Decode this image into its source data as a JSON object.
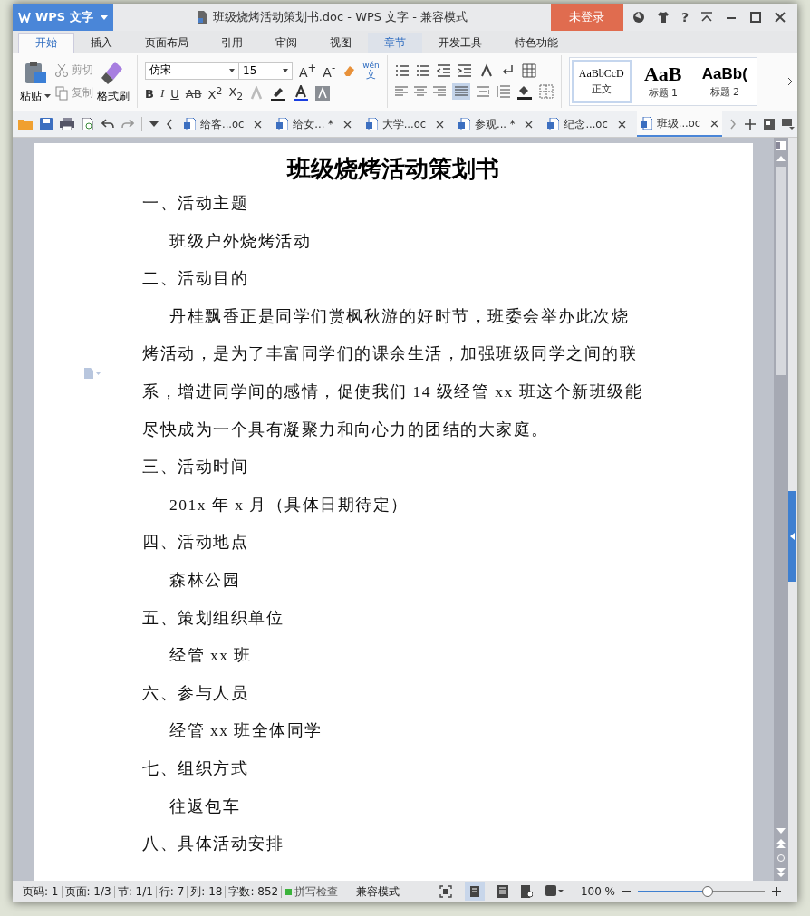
{
  "app_button": {
    "label": "WPS 文字"
  },
  "window": {
    "title": "班级烧烤活动策划书.doc - WPS 文字 - 兼容模式",
    "login": "未登录",
    "help": "?"
  },
  "menu_tabs": [
    {
      "label": "开始",
      "selected": true,
      "hovered": false
    },
    {
      "label": "插入",
      "selected": false,
      "hovered": false
    },
    {
      "label": "页面布局",
      "selected": false,
      "hovered": false
    },
    {
      "label": "引用",
      "selected": false,
      "hovered": false
    },
    {
      "label": "审阅",
      "selected": false,
      "hovered": false
    },
    {
      "label": "视图",
      "selected": false,
      "hovered": false
    },
    {
      "label": "章节",
      "selected": false,
      "hovered": true
    },
    {
      "label": "开发工具",
      "selected": false,
      "hovered": false
    },
    {
      "label": "特色功能",
      "selected": false,
      "hovered": false
    }
  ],
  "ribbon": {
    "paste": "粘贴",
    "cut": {
      "label": "剪切",
      "disabled": true
    },
    "copy": {
      "label": "复制",
      "disabled": true
    },
    "format_painter": "格式刷",
    "font": "仿宋",
    "size": "15",
    "grow": "A$^{+}$",
    "shrink": "A$^{-}$",
    "phonetic_top": "wén",
    "phonetic_bottom": "文",
    "format_buttons": [
      "B",
      "I",
      "U",
      "AB",
      "X$^{2}$",
      "X$_{2}$"
    ],
    "styles": [
      {
        "preview": "AaBbCcD",
        "name": "正文",
        "kind": "normal",
        "selected": true
      },
      {
        "preview": "AaB",
        "name": "标题 1",
        "kind": "h1",
        "selected": false
      },
      {
        "preview": "AaBb(",
        "name": "标题 2",
        "kind": "h2",
        "selected": false
      }
    ]
  },
  "doc_tabs": [
    {
      "label": "给客...oc",
      "selected": false
    },
    {
      "label": "给女... *",
      "selected": false
    },
    {
      "label": "大学...oc",
      "selected": false
    },
    {
      "label": "参观... *",
      "selected": false
    },
    {
      "label": "纪念...oc",
      "selected": false
    },
    {
      "label": "班级...oc",
      "selected": true
    }
  ],
  "document": {
    "title": "班级烧烤活动策划书",
    "paragraphs": [
      {
        "kind": "heading",
        "text": "一、活动主题"
      },
      {
        "kind": "item",
        "text": "班级户外烧烤活动"
      },
      {
        "kind": "heading",
        "text": "二、活动目的"
      },
      {
        "kind": "body",
        "text": "丹桂飘香正是同学们赏枫秋游的好时节，班委会举办此次烧烤活动，是为了丰富同学们的课余生活，加强班级同学之间的联系，增进同学间的感情，促使我们 14 级经管 xx 班这个新班级能尽快成为一个具有凝聚力和向心力的团结的大家庭。"
      },
      {
        "kind": "heading",
        "text": "三、活动时间"
      },
      {
        "kind": "item",
        "text": "201x 年 x 月（具体日期待定）"
      },
      {
        "kind": "heading",
        "text": "四、活动地点"
      },
      {
        "kind": "item",
        "text": "森林公园"
      },
      {
        "kind": "heading",
        "text": "五、策划组织单位"
      },
      {
        "kind": "item",
        "text": "经管 xx 班"
      },
      {
        "kind": "heading",
        "text": "六、参与人员"
      },
      {
        "kind": "item",
        "text": "经管 xx 班全体同学"
      },
      {
        "kind": "heading",
        "text": "七、组织方式"
      },
      {
        "kind": "item",
        "text": "往返包车"
      },
      {
        "kind": "heading",
        "text": "八、具体活动安排"
      }
    ]
  },
  "status_bar": {
    "fields": [
      "页码: 1",
      "页面: 1/3",
      "节: 1/1",
      "行: 7",
      "列: 18",
      "字数: 852"
    ],
    "spell_check": {
      "label": "拼写检查",
      "on": true
    },
    "mode": "兼容模式",
    "zoom": "100 %",
    "zoom_slider": {
      "level": 0.55
    }
  }
}
